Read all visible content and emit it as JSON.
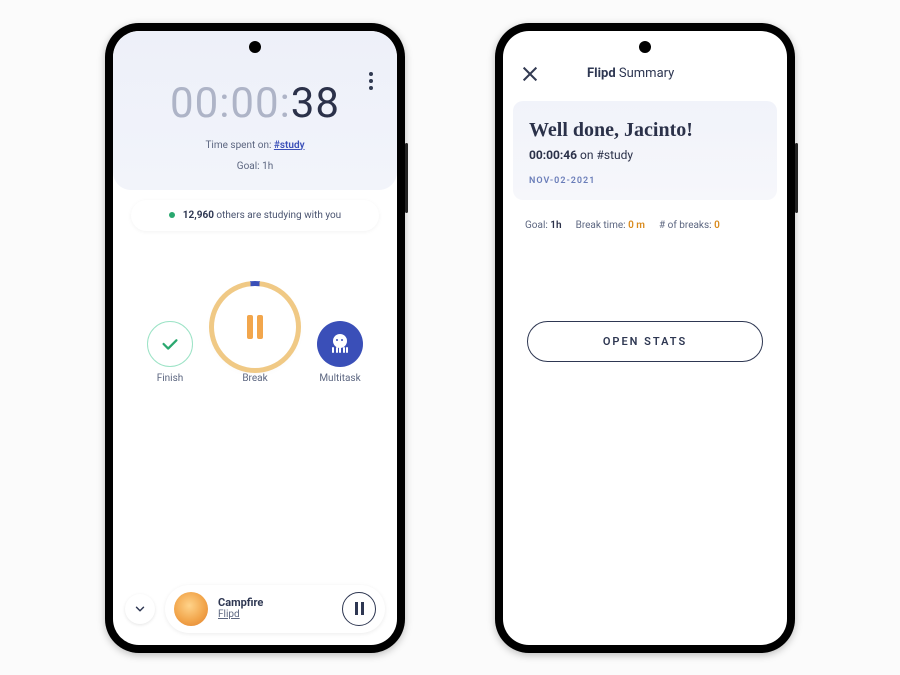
{
  "left": {
    "timer_faded": "00:00:",
    "timer_seconds": "38",
    "time_spent_prefix": "Time spent on: ",
    "tag": "#study",
    "goal": "Goal: 1h",
    "studying_count": "12,960",
    "studying_suffix": " others are studying with you",
    "buttons": {
      "finish": "Finish",
      "break": "Break",
      "multitask": "Multitask"
    },
    "player": {
      "track": "Campfire",
      "artist": "Flipd"
    }
  },
  "right": {
    "app_bold": "Flipd",
    "app_rest": " Summary",
    "congrats": "Well done, Jacinto!",
    "duration": "00:00:46",
    "duration_suffix": " on #study",
    "date": "NOV-02-2021",
    "goal_label": "Goal:",
    "goal_value": "1h",
    "break_label": "Break time:",
    "break_value": "0 m",
    "count_label": "# of breaks:",
    "count_value": "0",
    "open_stats": "OPEN STATS"
  }
}
